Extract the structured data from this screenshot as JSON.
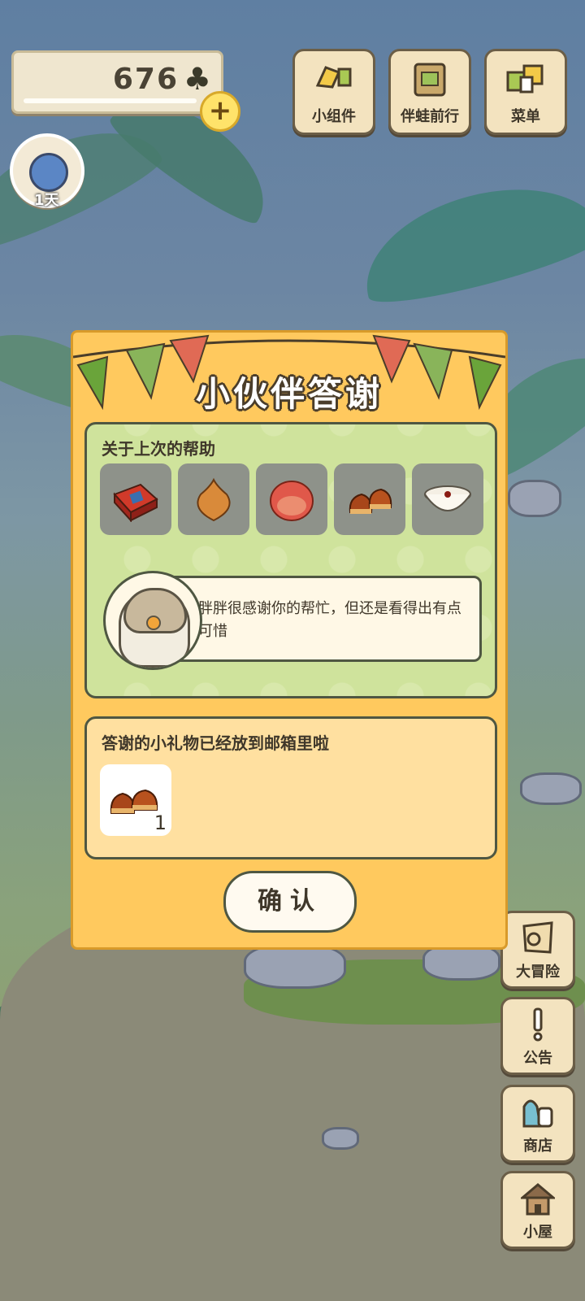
{
  "hud": {
    "currency_amount": "676",
    "currency_icon": "clover-icon",
    "add_icon": "plus",
    "day_label": "1天"
  },
  "top_buttons": [
    {
      "label": "小组件",
      "icon": "widget-icon"
    },
    {
      "label": "伴蛙前行",
      "icon": "album-icon"
    },
    {
      "label": "菜单",
      "icon": "menu-icon"
    }
  ],
  "side_buttons": [
    {
      "label": "大冒险",
      "icon": "map-icon"
    },
    {
      "label": "公告",
      "icon": "exclamation-icon"
    },
    {
      "label": "商店",
      "icon": "bag-icon"
    },
    {
      "label": "小屋",
      "icon": "house-icon"
    }
  ],
  "dialog": {
    "title": "小伙伴答谢",
    "help_section": {
      "label": "关于上次的帮助",
      "items": [
        "gift-box",
        "onion",
        "apple",
        "chestnuts",
        "rice-bowl"
      ]
    },
    "message": "胖胖很感谢你的帮忙，但还是看得出有点可惜",
    "gift_section": {
      "label": "答谢的小礼物已经放到邮箱里啦",
      "gift_item": "chestnuts",
      "gift_count": "1"
    },
    "confirm_label": "确认"
  },
  "colors": {
    "dialog_bg": "#ffc95e",
    "help_bg": "#cfe39c",
    "gift_bg": "#ffe0a0",
    "button_bg": "#f3e3bf"
  }
}
